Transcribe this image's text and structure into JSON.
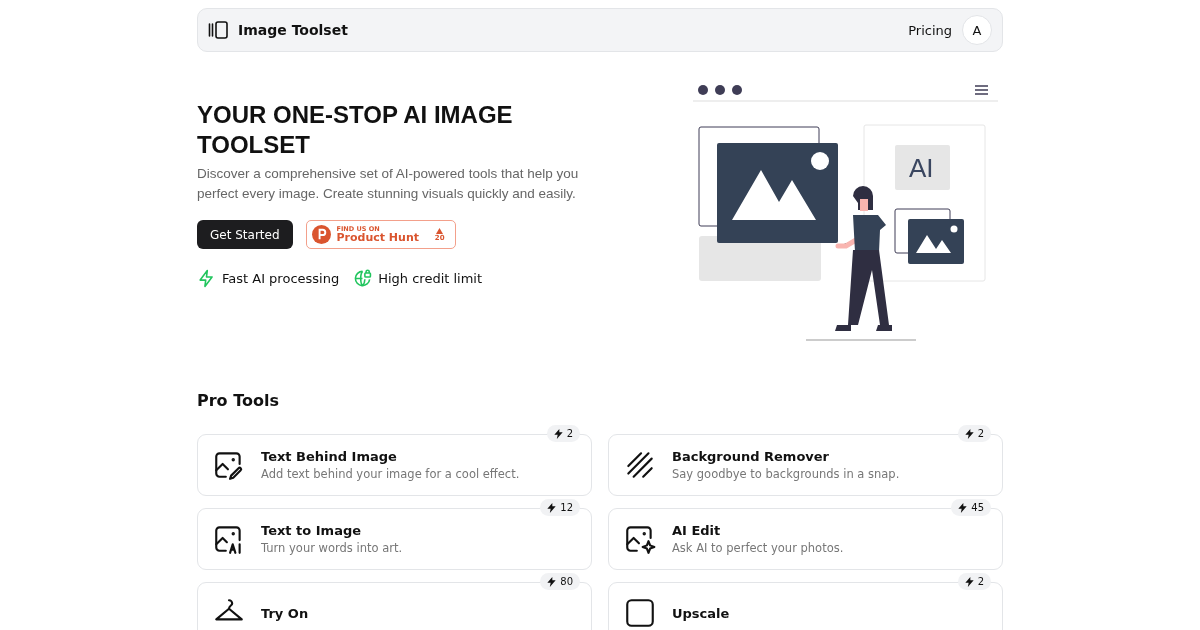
{
  "nav": {
    "brand": "Image Toolset",
    "links": [
      "Pricing"
    ],
    "avatar": "A"
  },
  "hero": {
    "title": "YOUR ONE-STOP AI IMAGE TOOLSET",
    "description": "Discover a comprehensive set of AI-powered tools that help you perfect every image. Create stunning visuals quickly and easily.",
    "cta": "Get Started",
    "product_hunt": {
      "small": "FIND US ON",
      "name": "Product Hunt",
      "votes": "20"
    },
    "features": [
      "Fast AI processing",
      "High credit limit"
    ],
    "illustration_label": "AI"
  },
  "section_title": "Pro Tools",
  "tools": [
    {
      "title": "Text Behind Image",
      "description": "Add text behind your image for a cool effect.",
      "credits": "2"
    },
    {
      "title": "Background Remover",
      "description": "Say goodbye to backgrounds in a snap.",
      "credits": "2"
    },
    {
      "title": "Text to Image",
      "description": "Turn your words into art.",
      "credits": "12"
    },
    {
      "title": "AI Edit",
      "description": "Ask AI to perfect your photos.",
      "credits": "45"
    },
    {
      "title": "Try On",
      "credits": "80"
    },
    {
      "title": "Upscale",
      "credits": "2"
    }
  ]
}
